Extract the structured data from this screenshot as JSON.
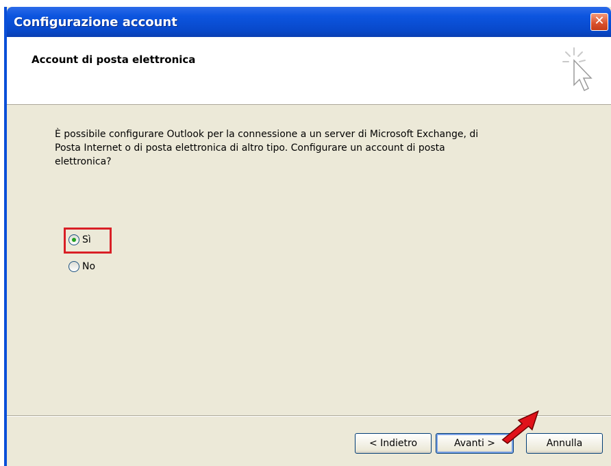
{
  "window": {
    "title": "Configurazione account",
    "close_symbol": "✕"
  },
  "header": {
    "heading": "Account di posta elettronica",
    "icon": "cursor-sparkle-icon"
  },
  "body": {
    "description": "È possibile configurare Outlook per la connessione a un server di Microsoft Exchange, di Posta Internet o di posta elettronica di altro tipo. Configurare un account di posta elettronica?"
  },
  "options": {
    "yes_label": "Sì",
    "no_label": "No",
    "selected": "Sì"
  },
  "buttons": {
    "back": "< Indietro",
    "next": "Avanti >",
    "cancel": "Annulla"
  },
  "colors": {
    "titlebar": "#0a4fd8",
    "highlight_box": "#d91f26",
    "arrow": "#e0121a"
  }
}
